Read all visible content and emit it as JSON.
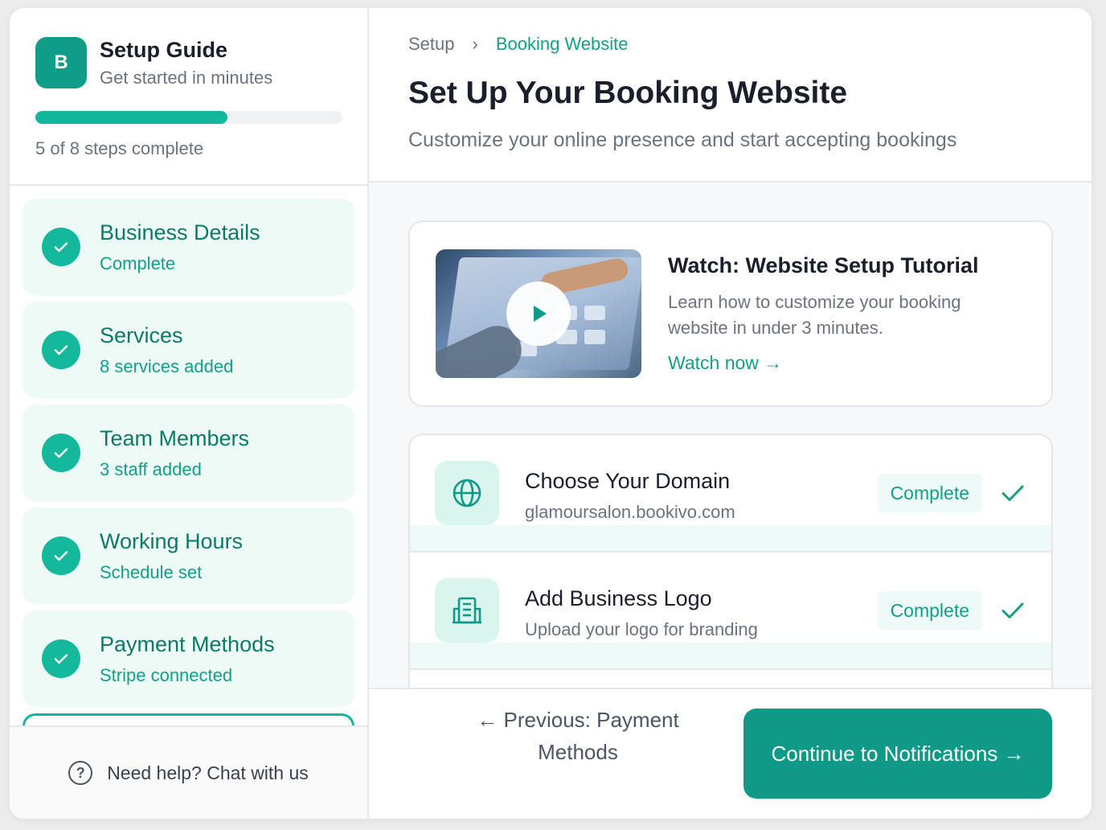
{
  "sidebar": {
    "logo_letter": "B",
    "title": "Setup Guide",
    "subtitle": "Get started in minutes",
    "progress": {
      "completed": 5,
      "total": 8,
      "fraction": 0.625,
      "label": "5 of 8 steps complete"
    },
    "steps": [
      {
        "title": "Business Details",
        "status": "Complete"
      },
      {
        "title": "Services",
        "status": "8 services added"
      },
      {
        "title": "Team Members",
        "status": "3 staff added"
      },
      {
        "title": "Working Hours",
        "status": "Schedule set"
      },
      {
        "title": "Payment Methods",
        "status": "Stripe connected"
      }
    ],
    "help": {
      "icon": "question-circle-icon",
      "text": "Need help? Chat with us"
    }
  },
  "main": {
    "breadcrumb": {
      "root": "Setup",
      "separator": "›",
      "current": "Booking Website"
    },
    "title": "Set Up Your Booking Website",
    "subtitle": "Customize your online presence and start accepting bookings",
    "video": {
      "title": "Watch: Website Setup Tutorial",
      "description": "Learn how to customize your booking website in under 3 minutes.",
      "link": "Watch now →"
    },
    "tasks": [
      {
        "title": "Choose Your Domain",
        "subtitle": "glamoursalon.bookivo.com",
        "badge": "Complete",
        "icon": "globe-icon"
      },
      {
        "title": "Add Business Logo",
        "subtitle": "Upload your logo for branding",
        "badge": "Complete",
        "icon": "building-icon"
      }
    ],
    "footer": {
      "prev_label": "← Previous: Payment Methods",
      "next_label": "Continue to Notifications →"
    }
  },
  "colors": {
    "accent": "#0e9a86",
    "accent_light": "#edfaf6",
    "progress": "#13b89c"
  }
}
